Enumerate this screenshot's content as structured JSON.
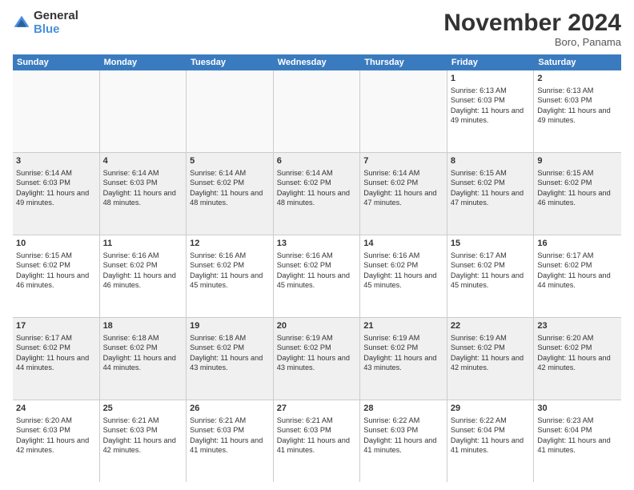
{
  "logo": {
    "line1": "General",
    "line2": "Blue"
  },
  "title": "November 2024",
  "location": "Boro, Panama",
  "weekdays": [
    "Sunday",
    "Monday",
    "Tuesday",
    "Wednesday",
    "Thursday",
    "Friday",
    "Saturday"
  ],
  "weeks": [
    [
      {
        "day": "",
        "info": ""
      },
      {
        "day": "",
        "info": ""
      },
      {
        "day": "",
        "info": ""
      },
      {
        "day": "",
        "info": ""
      },
      {
        "day": "",
        "info": ""
      },
      {
        "day": "1",
        "info": "Sunrise: 6:13 AM\nSunset: 6:03 PM\nDaylight: 11 hours and 49 minutes."
      },
      {
        "day": "2",
        "info": "Sunrise: 6:13 AM\nSunset: 6:03 PM\nDaylight: 11 hours and 49 minutes."
      }
    ],
    [
      {
        "day": "3",
        "info": "Sunrise: 6:14 AM\nSunset: 6:03 PM\nDaylight: 11 hours and 49 minutes."
      },
      {
        "day": "4",
        "info": "Sunrise: 6:14 AM\nSunset: 6:03 PM\nDaylight: 11 hours and 48 minutes."
      },
      {
        "day": "5",
        "info": "Sunrise: 6:14 AM\nSunset: 6:02 PM\nDaylight: 11 hours and 48 minutes."
      },
      {
        "day": "6",
        "info": "Sunrise: 6:14 AM\nSunset: 6:02 PM\nDaylight: 11 hours and 48 minutes."
      },
      {
        "day": "7",
        "info": "Sunrise: 6:14 AM\nSunset: 6:02 PM\nDaylight: 11 hours and 47 minutes."
      },
      {
        "day": "8",
        "info": "Sunrise: 6:15 AM\nSunset: 6:02 PM\nDaylight: 11 hours and 47 minutes."
      },
      {
        "day": "9",
        "info": "Sunrise: 6:15 AM\nSunset: 6:02 PM\nDaylight: 11 hours and 46 minutes."
      }
    ],
    [
      {
        "day": "10",
        "info": "Sunrise: 6:15 AM\nSunset: 6:02 PM\nDaylight: 11 hours and 46 minutes."
      },
      {
        "day": "11",
        "info": "Sunrise: 6:16 AM\nSunset: 6:02 PM\nDaylight: 11 hours and 46 minutes."
      },
      {
        "day": "12",
        "info": "Sunrise: 6:16 AM\nSunset: 6:02 PM\nDaylight: 11 hours and 45 minutes."
      },
      {
        "day": "13",
        "info": "Sunrise: 6:16 AM\nSunset: 6:02 PM\nDaylight: 11 hours and 45 minutes."
      },
      {
        "day": "14",
        "info": "Sunrise: 6:16 AM\nSunset: 6:02 PM\nDaylight: 11 hours and 45 minutes."
      },
      {
        "day": "15",
        "info": "Sunrise: 6:17 AM\nSunset: 6:02 PM\nDaylight: 11 hours and 45 minutes."
      },
      {
        "day": "16",
        "info": "Sunrise: 6:17 AM\nSunset: 6:02 PM\nDaylight: 11 hours and 44 minutes."
      }
    ],
    [
      {
        "day": "17",
        "info": "Sunrise: 6:17 AM\nSunset: 6:02 PM\nDaylight: 11 hours and 44 minutes."
      },
      {
        "day": "18",
        "info": "Sunrise: 6:18 AM\nSunset: 6:02 PM\nDaylight: 11 hours and 44 minutes."
      },
      {
        "day": "19",
        "info": "Sunrise: 6:18 AM\nSunset: 6:02 PM\nDaylight: 11 hours and 43 minutes."
      },
      {
        "day": "20",
        "info": "Sunrise: 6:19 AM\nSunset: 6:02 PM\nDaylight: 11 hours and 43 minutes."
      },
      {
        "day": "21",
        "info": "Sunrise: 6:19 AM\nSunset: 6:02 PM\nDaylight: 11 hours and 43 minutes."
      },
      {
        "day": "22",
        "info": "Sunrise: 6:19 AM\nSunset: 6:02 PM\nDaylight: 11 hours and 42 minutes."
      },
      {
        "day": "23",
        "info": "Sunrise: 6:20 AM\nSunset: 6:02 PM\nDaylight: 11 hours and 42 minutes."
      }
    ],
    [
      {
        "day": "24",
        "info": "Sunrise: 6:20 AM\nSunset: 6:03 PM\nDaylight: 11 hours and 42 minutes."
      },
      {
        "day": "25",
        "info": "Sunrise: 6:21 AM\nSunset: 6:03 PM\nDaylight: 11 hours and 42 minutes."
      },
      {
        "day": "26",
        "info": "Sunrise: 6:21 AM\nSunset: 6:03 PM\nDaylight: 11 hours and 41 minutes."
      },
      {
        "day": "27",
        "info": "Sunrise: 6:21 AM\nSunset: 6:03 PM\nDaylight: 11 hours and 41 minutes."
      },
      {
        "day": "28",
        "info": "Sunrise: 6:22 AM\nSunset: 6:03 PM\nDaylight: 11 hours and 41 minutes."
      },
      {
        "day": "29",
        "info": "Sunrise: 6:22 AM\nSunset: 6:04 PM\nDaylight: 11 hours and 41 minutes."
      },
      {
        "day": "30",
        "info": "Sunrise: 6:23 AM\nSunset: 6:04 PM\nDaylight: 11 hours and 41 minutes."
      }
    ]
  ]
}
